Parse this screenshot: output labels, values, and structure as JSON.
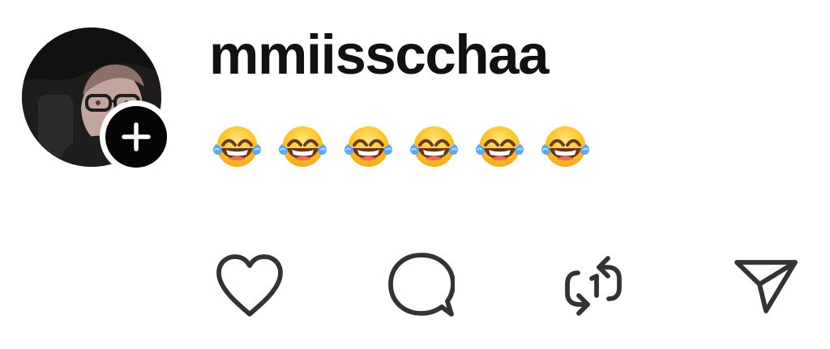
{
  "post": {
    "username": "mmiisscchaa",
    "message": "😂😂😂😂😂😂",
    "emoji_count": 6,
    "icons": {
      "follow": "plus-icon",
      "like": "heart-icon",
      "comment": "comment-bubble-icon",
      "repost": "repost-icon",
      "share": "send-icon"
    },
    "colors": {
      "text": "#111111",
      "icons": "#333333",
      "badge": "#050505",
      "background": "#ffffff"
    }
  }
}
